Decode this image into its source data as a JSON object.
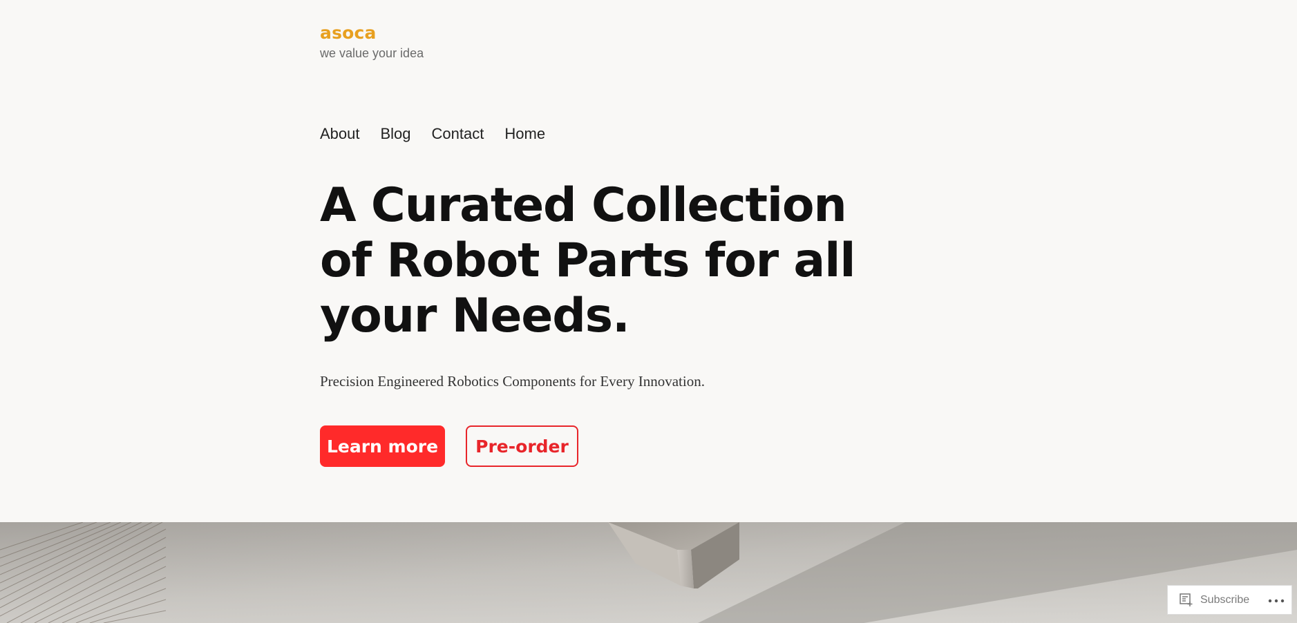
{
  "site": {
    "title": "asoca",
    "tagline": "we value your idea",
    "brand_color": "#e8a020"
  },
  "nav": {
    "items": [
      {
        "label": "About"
      },
      {
        "label": "Blog"
      },
      {
        "label": "Contact"
      },
      {
        "label": "Home"
      }
    ]
  },
  "hero": {
    "title": "A Curated Collection of Robot Parts for all your Needs.",
    "subtitle": "Precision Engineered Robotics Components for Every Innovation.",
    "primary_button": "Learn more",
    "secondary_button": "Pre-order",
    "accent_color": "#ff2a2a"
  },
  "footer_bar": {
    "subscribe_label": "Subscribe",
    "subscribe_icon": "reader-subscribe-icon",
    "more_icon": "more-horizontal-icon"
  }
}
